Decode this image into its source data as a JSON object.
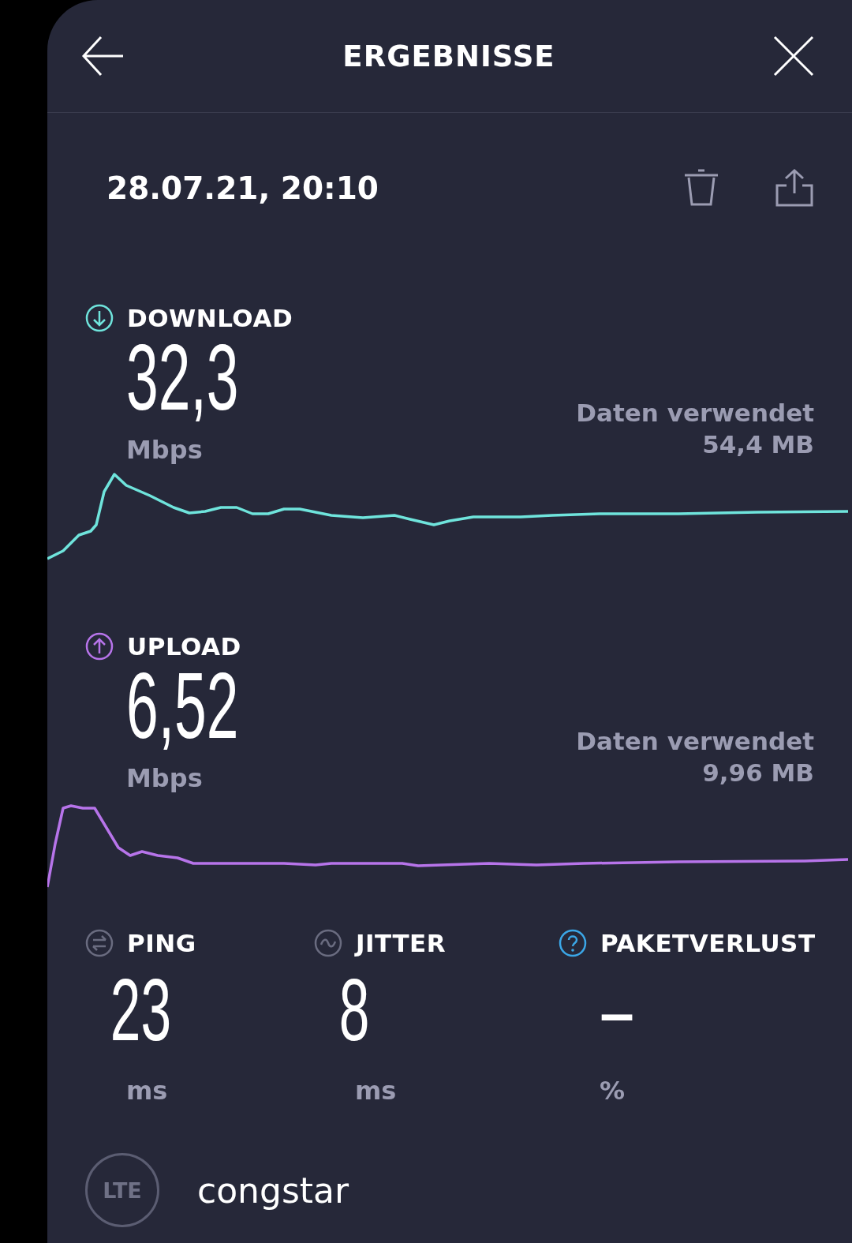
{
  "header": {
    "title": "ERGEBNISSE"
  },
  "timestamp": "28.07.21, 20:10",
  "speeds": [
    {
      "kind": "download",
      "label": "DOWNLOAD",
      "value": "32,3",
      "unit": "Mbps",
      "data_label": "Daten verwendet",
      "data_value": "54,4 MB"
    },
    {
      "kind": "upload",
      "label": "UPLOAD",
      "value": "6,52",
      "unit": "Mbps",
      "data_label": "Daten verwendet",
      "data_value": "9,96 MB"
    }
  ],
  "metrics": [
    {
      "kind": "ping",
      "label": "PING",
      "value": "23",
      "unit": "ms"
    },
    {
      "kind": "jitter",
      "label": "JITTER",
      "value": "8",
      "unit": "ms"
    },
    {
      "kind": "packet_loss",
      "label": "PAKETVERLUST",
      "value": "–",
      "unit": "%"
    }
  ],
  "connection": {
    "type": "LTE",
    "provider": "congstar"
  }
}
